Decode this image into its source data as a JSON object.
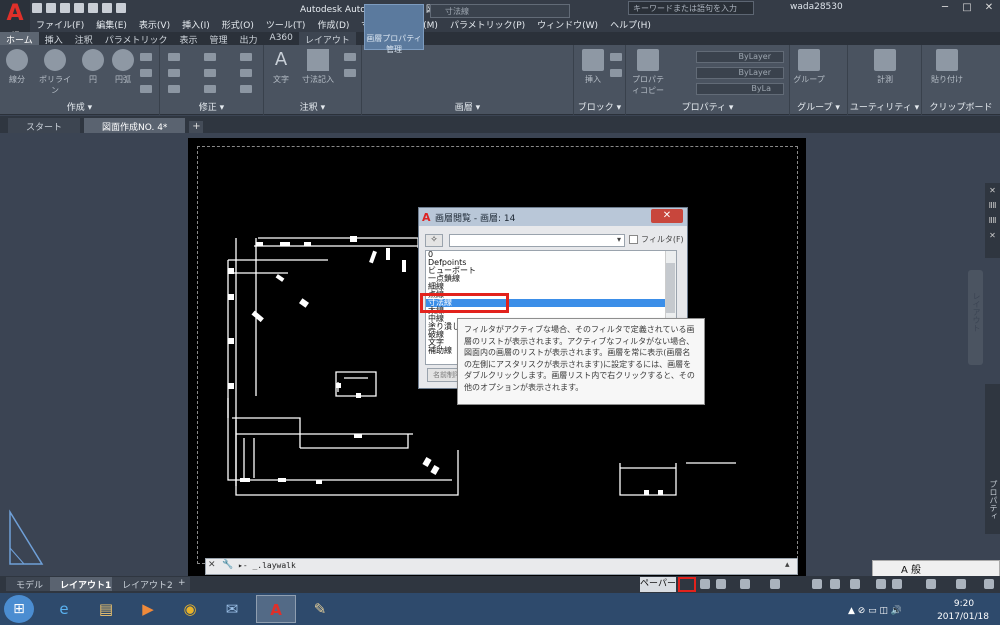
{
  "titlebar": {
    "app_logo": "A",
    "app_logo_sub": "LT",
    "title": "Autodesk AutoCAD LT 2017    図面作成NO. 4.dwg",
    "search_placeholder": "キーワードまたは語句を入力",
    "user": "wada28530",
    "window_buttons": [
      "─",
      "□",
      "✕"
    ]
  },
  "menubar": {
    "items": [
      "ファイル(F)",
      "編集(E)",
      "表示(V)",
      "挿入(I)",
      "形式(O)",
      "ツール(T)",
      "作成(D)",
      "寸法(N)",
      "修正(M)",
      "パラメトリック(P)",
      "ウィンドウ(W)",
      "ヘルプ(H)"
    ]
  },
  "ribbon": {
    "tabs": [
      "ホーム",
      "挿入",
      "注釈",
      "パラメトリック",
      "表示",
      "管理",
      "出力",
      "A360",
      "レイアウト"
    ],
    "active_tab": "ホーム",
    "groups": [
      "作成 ▾",
      "修正 ▾",
      "注釈 ▾",
      "画層 ▾",
      "ブロック ▾",
      "プロパティ ▾",
      "グループ ▾",
      "ユーティリティ ▾",
      "クリップボード"
    ],
    "create_tools": [
      "線分",
      "ポリライン",
      "円",
      "円弧"
    ],
    "annotation_tools": [
      "文字",
      "寸法記入"
    ],
    "highlight_button": "画層プロパティ管理",
    "layer_select": "寸法線",
    "block_tools": [
      "挿入",
      "編集"
    ],
    "property_tools": [
      "プロパティコピー"
    ],
    "bylayer": [
      "ByLayer",
      "ByLayer",
      "ByLa"
    ],
    "group_tool": "グループ",
    "util_tool": "計測",
    "clip_tool": "貼り付け"
  },
  "filetabs": {
    "tabs": [
      "スタート",
      "図面作成NO. 4*"
    ],
    "add": "+"
  },
  "dialog": {
    "title": "画層閲覧 - 画層: 14",
    "close": "✕",
    "filter_button": "✧",
    "filter_dropdown_arrow": "▾",
    "filter_label": "フィルタ(F)",
    "layers": [
      "0",
      "Defpoints",
      "ビューポート",
      "一点鎖線",
      "細線",
      "点線",
      "寸法線",
      "太線",
      "中線",
      "塗り潰し",
      "破線",
      "文字",
      "補助線"
    ],
    "selected_layer": "寸法線",
    "bottom_button": "名前制限"
  },
  "tooltip": {
    "text": "フィルタがアクティブな場合、そのフィルタで定義されている画層のリストが表示されます。アクティブなフィルタがない場合、図面内の画層のリストが表示されます。画層を常に表示(画層名の左側にアスタリスクが表示されます)に設定するには、画層をダブルクリックします。画層リスト内で右クリックすると、その他のオプションが表示されます。"
  },
  "cmdline": {
    "close": "✕",
    "wrench": "🔧",
    "prompt": "▸- _.laywalk",
    "up": "▴"
  },
  "right_palettes": {
    "label_main": "レイアウト",
    "label_props": "プロパティ",
    "ctrl_icons": [
      "✕",
      "ⅡⅡ",
      "ⅡⅡ",
      "✕"
    ]
  },
  "statusbar": {
    "layout_tabs": [
      "モデル",
      "レイアウト1",
      "レイアウト2",
      "+"
    ],
    "active_layout": "レイアウト1",
    "paper_label": "ペーパー"
  },
  "ime_bar": {
    "text": "A 般"
  },
  "taskbar": {
    "start": "⊞",
    "apps": [
      {
        "icon": "ie-icon",
        "glyph": "e",
        "color": "#5ab2f0"
      },
      {
        "icon": "explorer-icon",
        "glyph": "▤",
        "color": "#f2c66d"
      },
      {
        "icon": "media-player-icon",
        "glyph": "▶",
        "color": "#f08a3a"
      },
      {
        "icon": "chrome-icon",
        "glyph": "◉",
        "color": "#e8b32a"
      },
      {
        "icon": "thunderbird-icon",
        "glyph": "✉",
        "color": "#9ec3ea"
      },
      {
        "icon": "autocad-icon",
        "glyph": "A",
        "color": "#e0302a"
      },
      {
        "icon": "paint-icon",
        "glyph": "✎",
        "color": "#e6d09a"
      }
    ],
    "active_app": "autocad-icon",
    "tray": "▲ ⊘ ▭ ◫ 🔊",
    "clock_time": "9:20",
    "clock_date": "2017/01/18"
  },
  "colors": {
    "accent_blue": "#3b8ee8",
    "highlight_red": "#e2221c",
    "drawing_line": "#ffffff"
  }
}
